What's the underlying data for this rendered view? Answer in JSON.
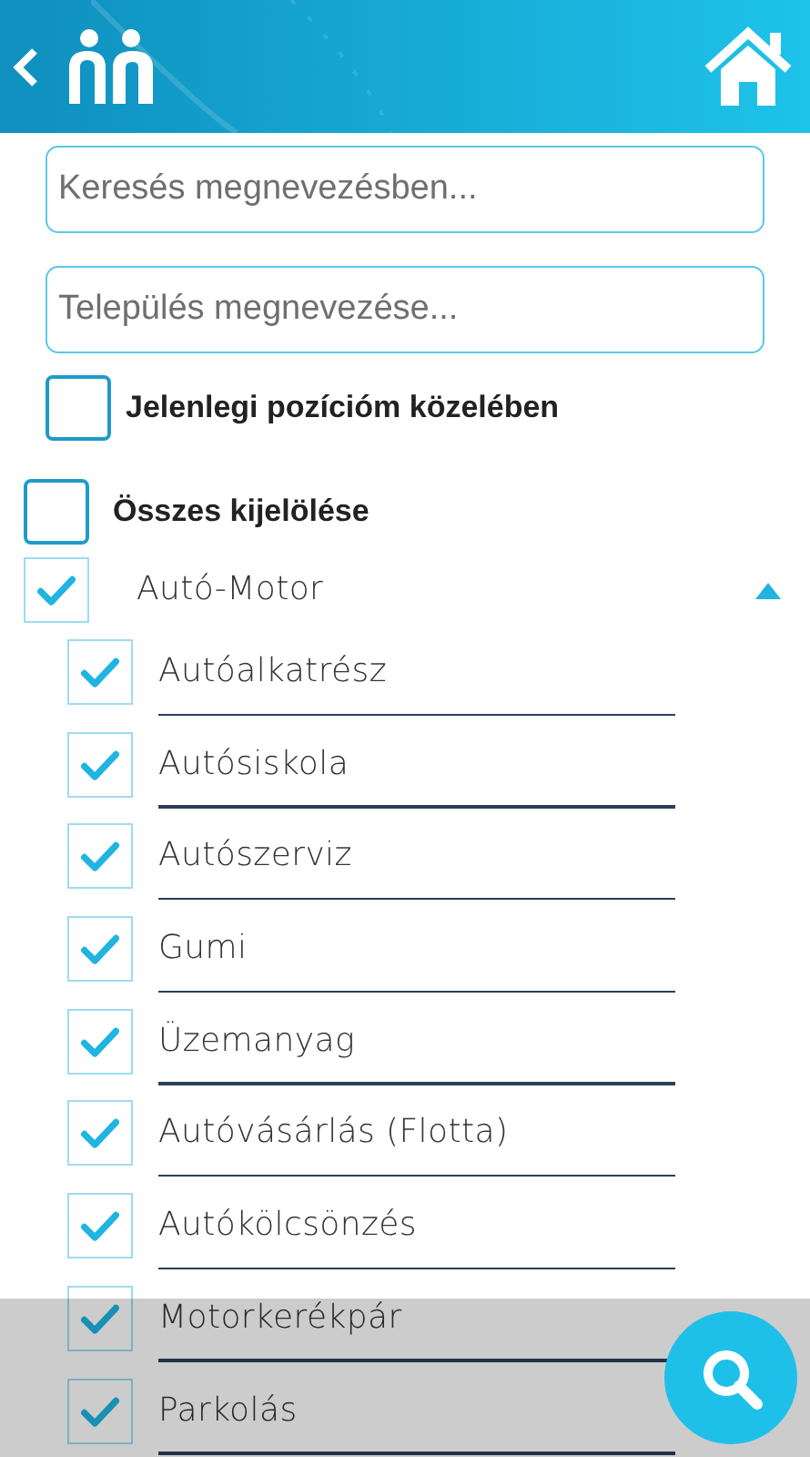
{
  "search": {
    "placeholder": "Keresés megnevezésben..."
  },
  "city": {
    "placeholder": "Település megnevezése..."
  },
  "near_me": {
    "label": "Jelenlegi pozícióm közelében",
    "checked": false
  },
  "select_all": {
    "label": "Összes kijelölése",
    "checked": false
  },
  "categories": [
    {
      "label": "Autó-Motor",
      "checked": true,
      "expanded": true,
      "children": [
        {
          "label": "Autóalkatrész",
          "checked": true
        },
        {
          "label": "Autósiskola",
          "checked": true
        },
        {
          "label": "Autószerviz",
          "checked": true
        },
        {
          "label": "Gumi",
          "checked": true
        },
        {
          "label": "Üzemanyag",
          "checked": true
        },
        {
          "label": "Autóvásárlás (Flotta)",
          "checked": true
        },
        {
          "label": "Autókölcsönzés",
          "checked": true
        },
        {
          "label": "Motorkerékpár",
          "checked": true
        },
        {
          "label": "Parkolás",
          "checked": true
        }
      ]
    }
  ]
}
